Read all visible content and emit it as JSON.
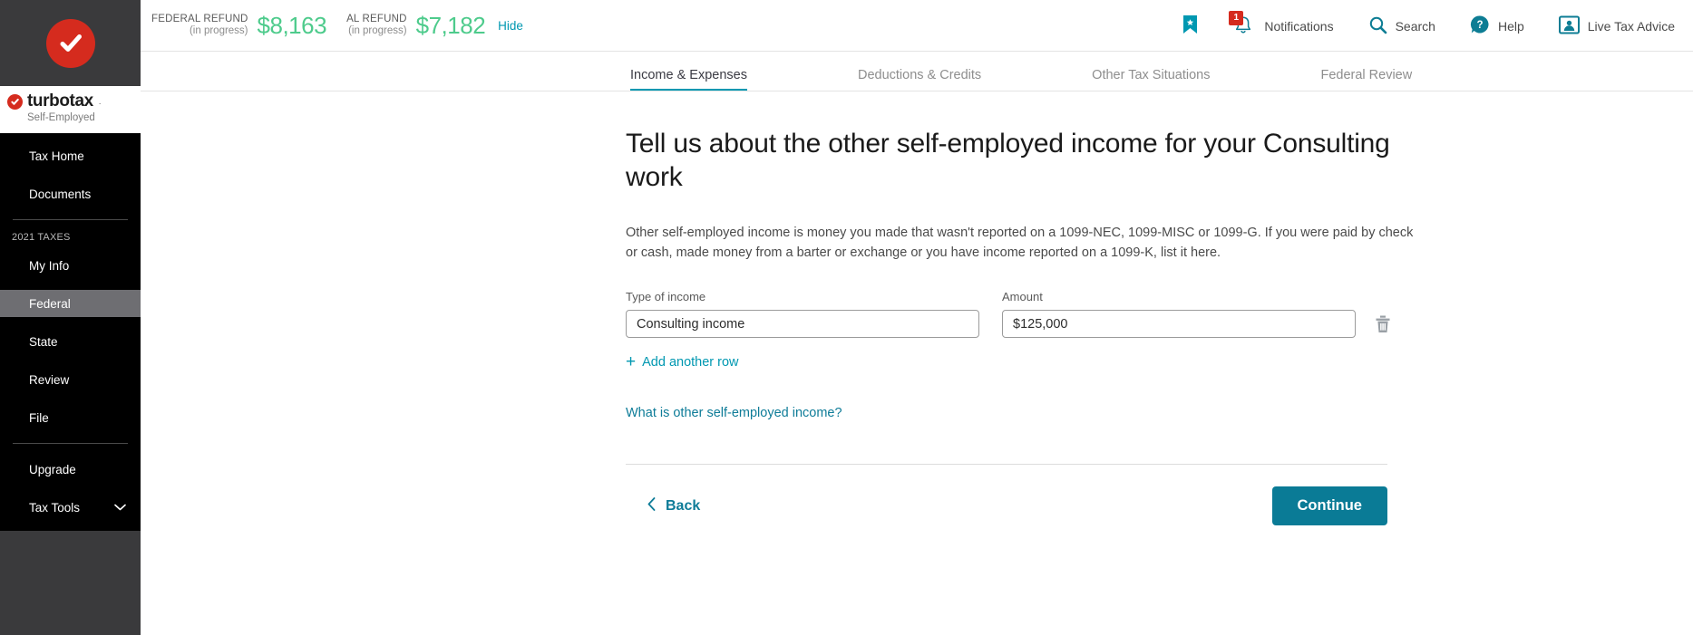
{
  "sidebar": {
    "logo_icon": "checkmark-circle-icon",
    "brand": {
      "name": "turbotax",
      "trademark": ".",
      "edition": "Self-Employed"
    },
    "top_items": [
      {
        "label": "Tax Home",
        "active": false
      },
      {
        "label": "Documents",
        "active": false
      }
    ],
    "section_label": "2021 TAXES",
    "tax_items": [
      {
        "label": "My Info",
        "active": false
      },
      {
        "label": "Federal",
        "active": true
      },
      {
        "label": "State",
        "active": false
      },
      {
        "label": "Review",
        "active": false
      },
      {
        "label": "File",
        "active": false
      }
    ],
    "bottom_items": [
      {
        "label": "Upgrade",
        "expandable": false
      },
      {
        "label": "Tax Tools",
        "expandable": true
      }
    ]
  },
  "header": {
    "federal_refund": {
      "label": "FEDERAL REFUND",
      "status": "(in progress)",
      "amount": "$8,163"
    },
    "state_refund": {
      "label": "AL REFUND",
      "status": "(in progress)",
      "amount": "$7,182"
    },
    "hide_label": "Hide",
    "bookmark_icon": "bookmark-icon",
    "notifications": {
      "icon": "bell-icon",
      "badge_count": "1",
      "label": "Notifications"
    },
    "search": {
      "icon": "search-icon",
      "label": "Search"
    },
    "help": {
      "icon": "question-circle-icon",
      "label": "Help"
    },
    "live_tax_advice": {
      "icon": "person-card-icon",
      "label": "Live Tax Advice"
    }
  },
  "tabs": [
    {
      "label": "Income & Expenses",
      "active": true
    },
    {
      "label": "Deductions & Credits",
      "active": false
    },
    {
      "label": "Other Tax Situations",
      "active": false
    },
    {
      "label": "Federal Review",
      "active": false
    }
  ],
  "main": {
    "title": "Tell us about the other self-employed income for your Consulting work",
    "description": "Other self-employed income is money you made that wasn't reported on a 1099-NEC, 1099-MISC or 1099-G. If you were paid by check or cash, made money from a barter or exchange or you have income reported on a 1099-K, list it here.",
    "form": {
      "type_label": "Type of income",
      "type_value": "Consulting income",
      "type_placeholder": "",
      "amount_label": "Amount",
      "amount_value": "$125,000",
      "amount_placeholder": "",
      "delete_icon": "trash-icon"
    },
    "add_row_label": "Add another row",
    "add_row_icon": "plus-icon",
    "help_link_label": "What is other self-employed income?",
    "back_label": "Back",
    "back_icon": "chevron-left-icon",
    "continue_label": "Continue"
  },
  "colors": {
    "brand_red": "#d52b1e",
    "accent_teal": "#0098b1",
    "continue_teal": "#0a7b96",
    "refund_green": "#4ecb8c",
    "sidebar_black": "#000000",
    "sidebar_gray": "#3a3a3c",
    "active_nav_gray": "#6e6e72"
  }
}
